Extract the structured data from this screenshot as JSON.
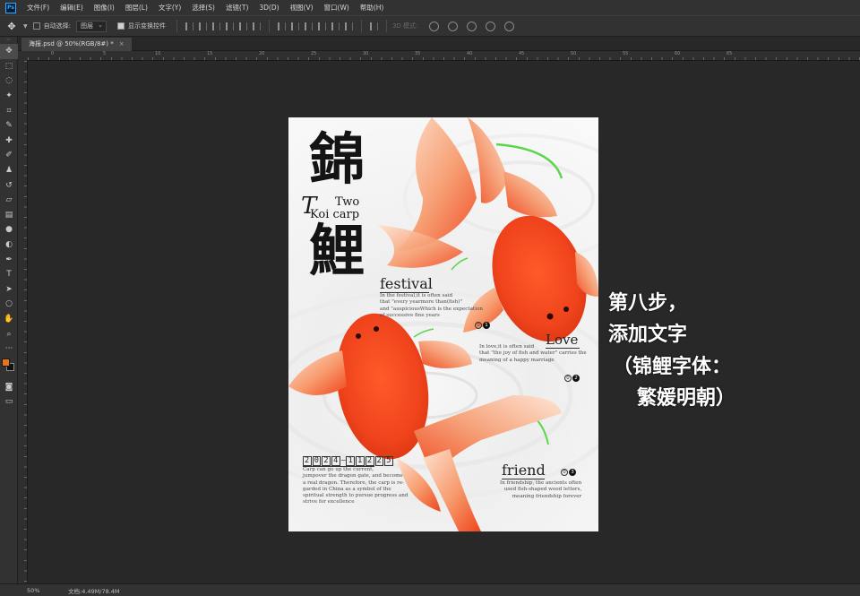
{
  "menu": {
    "logo": "Ps",
    "items": [
      "文件(F)",
      "编辑(E)",
      "图像(I)",
      "图层(L)",
      "文字(Y)",
      "选择(S)",
      "滤镜(T)",
      "3D(D)",
      "视图(V)",
      "窗口(W)",
      "帮助(H)"
    ]
  },
  "options": {
    "auto_select_label": "自动选择:",
    "auto_select_value": "图层",
    "show_transform_label": "显示变换控件",
    "mode_3d_label": "3D 模式:"
  },
  "tab": {
    "title": "海报.psd @ 50%(RGB/8#) *",
    "close": "×"
  },
  "toolbar": {
    "tools": [
      "move",
      "marquee",
      "lasso",
      "magic-wand",
      "crop",
      "eyedropper",
      "healing",
      "brush",
      "stamp",
      "history-brush",
      "eraser",
      "gradient",
      "blur",
      "dodge",
      "pen",
      "type",
      "path-select",
      "shape",
      "hand",
      "zoom",
      "more"
    ],
    "fg_color": "#e8731c",
    "bg_color": "#111111"
  },
  "rulers": {
    "top_ticks": [
      "0",
      "5",
      "10",
      "15",
      "20",
      "25",
      "30",
      "35",
      "40",
      "45",
      "50",
      "55",
      "60",
      "65"
    ]
  },
  "poster": {
    "kanji_top": "錦",
    "kanji_bottom": "鯉",
    "script_letter": "T",
    "two": "Two",
    "koi_carp": "Koi carp",
    "festival": {
      "heading": "festival",
      "lines": [
        "In the festival,it is often said",
        "that \"every yearmore than(fish)\"",
        "and \"auspiciousWhich is the expectation",
        "of successive fine years"
      ],
      "num_a": "0",
      "num_b": "1"
    },
    "love": {
      "heading": "Love",
      "lines": [
        "In love,it is often said",
        "that \"the joy of fish and water\" carries the",
        "meaning of a happy marriage"
      ],
      "num_a": "0",
      "num_b": "2"
    },
    "friend": {
      "heading": "friend",
      "lines": [
        "In friendship, the ancients often",
        "used fish-shaped wood letters,",
        "meaning friendship forever"
      ],
      "num_a": "0",
      "num_b": "3"
    },
    "date": [
      "2",
      "0",
      "2",
      "4",
      "–",
      "1",
      "1",
      "2",
      "2",
      "5"
    ],
    "carp_lines": [
      "Carp can go up the current,",
      "jumpover the dragon gate, and become",
      "a real dragon. Therefore, the carp is re-",
      "garded in China as a symbol of the",
      "spiritual strength to pursue progress and",
      "strive for excellence"
    ],
    "fish_color": "#f0441c",
    "accent_green": "#5ad64a"
  },
  "caption": {
    "line1": "第八步，",
    "line2": "添加文字",
    "line3": "（锦鲤字体：",
    "line4": "繁媛明朝）"
  },
  "status": {
    "zoom": "50%",
    "doc": "文档:4.49M/78.4M"
  }
}
